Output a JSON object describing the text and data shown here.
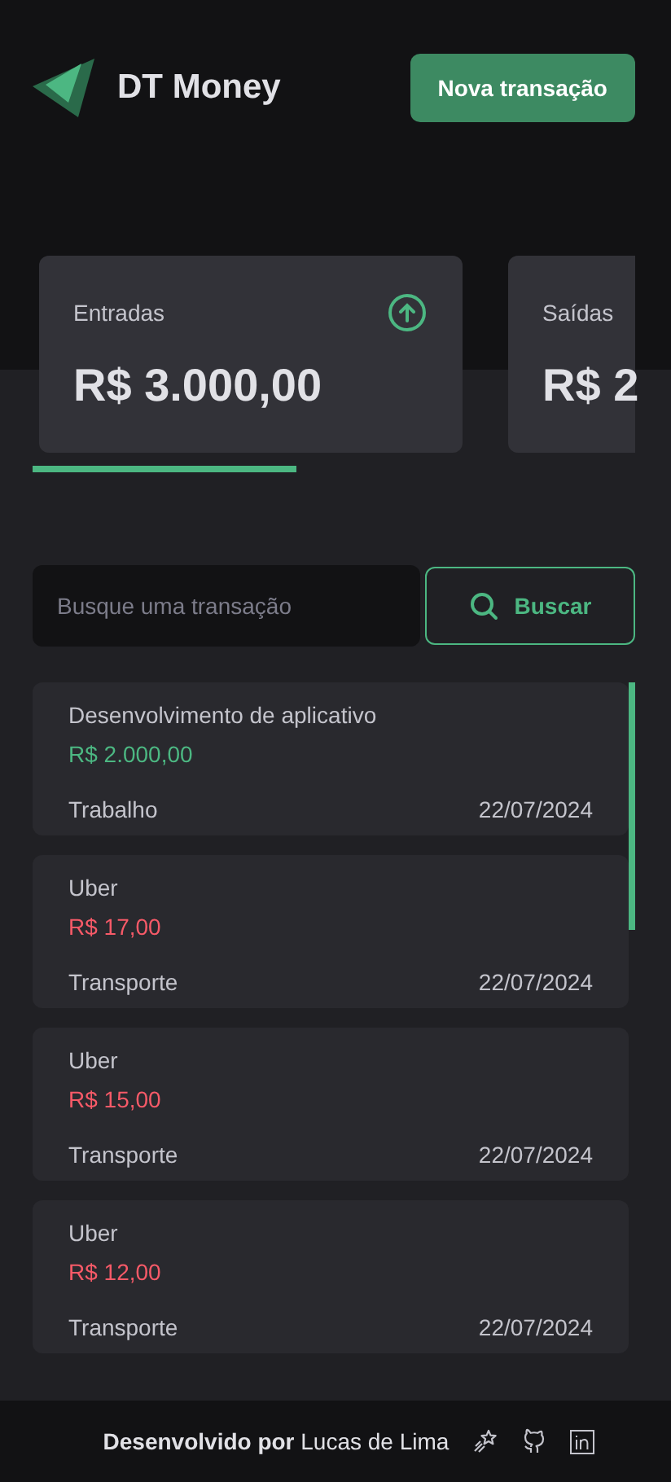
{
  "header": {
    "title": "DT Money",
    "button": "Nova transação"
  },
  "summary": [
    {
      "label": "Entradas",
      "value": "R$ 3.000,00",
      "kind": "income"
    },
    {
      "label": "Saídas",
      "value": "R$ 2"
    }
  ],
  "search": {
    "placeholder": "Busque uma transação",
    "button": "Buscar"
  },
  "transactions": [
    {
      "description": "Desenvolvimento de aplicativo",
      "amount": "R$ 2.000,00",
      "kind": "income",
      "category": "Trabalho",
      "date": "22/07/2024"
    },
    {
      "description": "Uber",
      "amount": "R$ 17,00",
      "kind": "outcome",
      "category": "Transporte",
      "date": "22/07/2024"
    },
    {
      "description": "Uber",
      "amount": "R$ 15,00",
      "kind": "outcome",
      "category": "Transporte",
      "date": "22/07/2024"
    },
    {
      "description": "Uber",
      "amount": "R$ 12,00",
      "kind": "outcome",
      "category": "Transporte",
      "date": "22/07/2024"
    }
  ],
  "footer": {
    "credit": "**Desenvolvido por** Lucas de Lima"
  }
}
